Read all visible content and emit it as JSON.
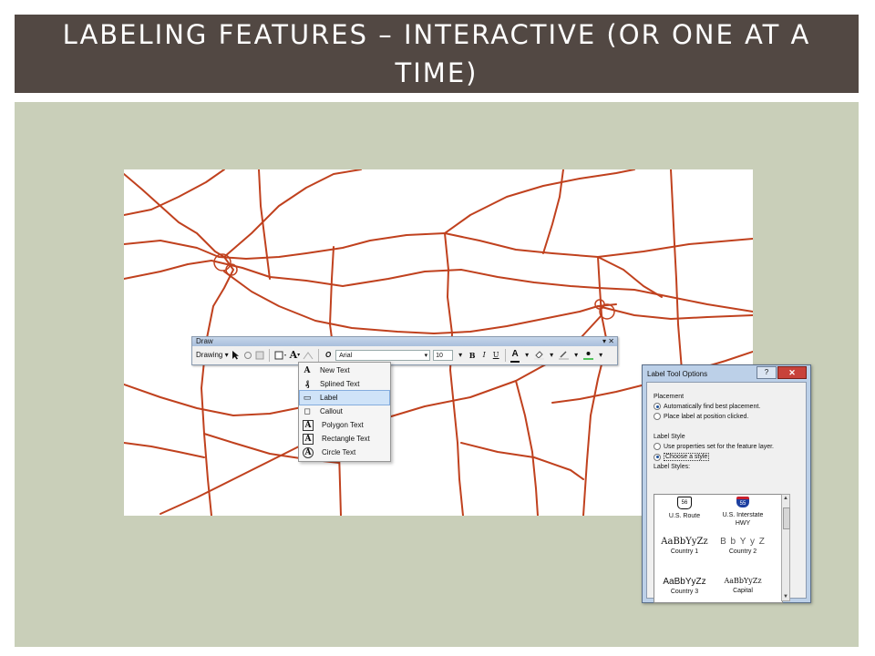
{
  "slide": {
    "title": "LABELING FEATURES – INTERACTIVE (OR ONE AT A TIME)",
    "colors": {
      "title_bg": "#524843",
      "body_bg": "#c9cfb9",
      "roads": "#c0411e"
    }
  },
  "draw_toolbar": {
    "title": "Draw",
    "close": "▾ ✕",
    "drawing_menu": "Drawing ▾",
    "font_name": "Arial",
    "font_size": "10",
    "bold": "B",
    "italic": "I",
    "underline": "U",
    "font_color": "A"
  },
  "text_menu": {
    "items": [
      {
        "label": "New Text",
        "icon": "text-icon",
        "glyph": "A"
      },
      {
        "label": "Splined Text",
        "icon": "splined-text-icon",
        "glyph": "₰"
      },
      {
        "label": "Label",
        "icon": "label-icon",
        "glyph": "▭",
        "selected": true
      },
      {
        "label": "Callout",
        "icon": "callout-icon",
        "glyph": "◻"
      },
      {
        "label": "Polygon Text",
        "icon": "polygon-text-icon",
        "glyph": "A"
      },
      {
        "label": "Rectangle Text",
        "icon": "rectangle-text-icon",
        "glyph": "A"
      },
      {
        "label": "Circle Text",
        "icon": "circle-text-icon",
        "glyph": "A"
      }
    ]
  },
  "dialog": {
    "title": "Label Tool Options",
    "help": "?",
    "close": "✕",
    "placement": {
      "label": "Placement",
      "option1": "Automatically find best placement.",
      "option2": "Place label at position clicked."
    },
    "label_style": {
      "label": "Label Style",
      "option1": "Use properties set for the feature layer.",
      "option2": "Choose a style"
    },
    "styles_label": "Label Styles:",
    "styles": [
      {
        "sample": "56",
        "name": "U.S. Route"
      },
      {
        "sample": "55",
        "name": "U.S. Interstate HWY"
      },
      {
        "sample": "AaBbYyZz",
        "name": "Country 1"
      },
      {
        "sample": "B b Y y Z",
        "name": "Country 2"
      },
      {
        "sample": "AaBbYyZz",
        "name": "Country 3"
      },
      {
        "sample": "AaBbYyZz",
        "name": "Capital"
      }
    ]
  }
}
